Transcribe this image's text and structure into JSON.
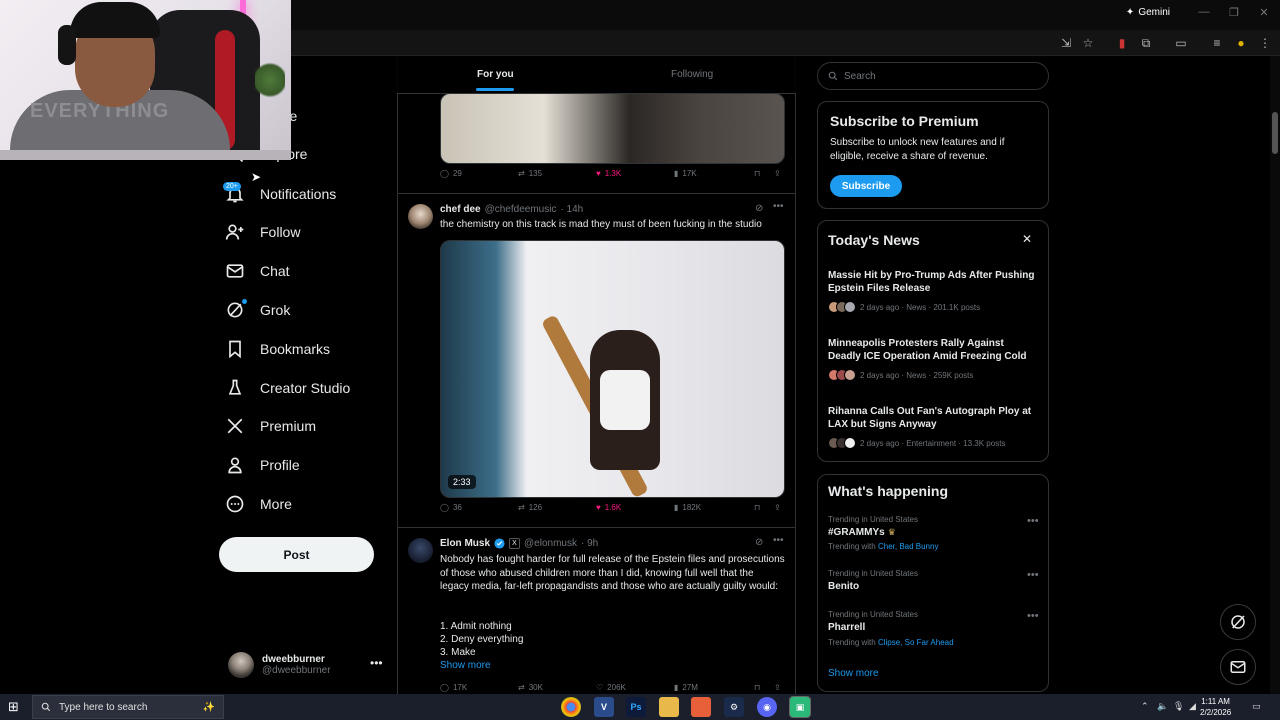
{
  "browser": {
    "gemini_label": "Gemini"
  },
  "nav": {
    "items": [
      {
        "id": "home",
        "label": "Home"
      },
      {
        "id": "explore",
        "label": "Explore"
      },
      {
        "id": "notifications",
        "label": "Notifications",
        "badge": "20+"
      },
      {
        "id": "follow",
        "label": "Follow"
      },
      {
        "id": "chat",
        "label": "Chat"
      },
      {
        "id": "grok",
        "label": "Grok"
      },
      {
        "id": "bookmarks",
        "label": "Bookmarks"
      },
      {
        "id": "creator-studio",
        "label": "Creator Studio"
      },
      {
        "id": "premium",
        "label": "Premium"
      },
      {
        "id": "profile",
        "label": "Profile"
      },
      {
        "id": "more",
        "label": "More"
      }
    ],
    "post_label": "Post",
    "account": {
      "name": "dweebburner",
      "handle": "@dweebburner"
    }
  },
  "feed": {
    "tabs": [
      {
        "label": "For you",
        "active": true
      },
      {
        "label": "Following",
        "active": false
      }
    ],
    "tweets": [
      {
        "actions": {
          "replies": "29",
          "reposts": "135",
          "likes": "1.3K",
          "views": "17K"
        }
      },
      {
        "name": "chef dee",
        "handle": "@chefdeemusic",
        "time": "· 14h",
        "text": "the chemistry on this track is mad they must of been fucking in the studio",
        "duration": "2:33",
        "actions": {
          "replies": "36",
          "reposts": "126",
          "likes": "1.6K",
          "views": "182K"
        }
      },
      {
        "name": "Elon Musk",
        "handle": "@elonmusk",
        "time": "· 9h",
        "text": "Nobody has fought harder for full release of the Epstein files and prosecutions of those who abused children more than I did, knowing full well that the legacy media, far-left propagandists and those who are actually guilty would:",
        "list": [
          "1. Admit nothing",
          "2. Deny everything",
          "3. Make"
        ],
        "show_more": "Show more",
        "actions": {
          "replies": "17K",
          "reposts": "30K",
          "likes": "206K",
          "views": "27M"
        }
      }
    ]
  },
  "sidebar": {
    "search_placeholder": "Search",
    "premium": {
      "title": "Subscribe to Premium",
      "body": "Subscribe to unlock new features and if eligible, receive a share of revenue.",
      "button": "Subscribe"
    },
    "news": {
      "title": "Today's News",
      "items": [
        {
          "title": "Massie Hit by Pro-Trump Ads After Pushing Epstein Files Release",
          "meta": "2 days ago · News · 201.1K posts"
        },
        {
          "title": "Minneapolis Protesters Rally Against Deadly ICE Operation Amid Freezing Cold",
          "meta": "2 days ago · News · 259K posts"
        },
        {
          "title": "Rihanna Calls Out Fan's Autograph Ploy at LAX but Signs Anyway",
          "meta": "2 days ago · Entertainment · 13.3K posts"
        }
      ]
    },
    "happening": {
      "title": "What's happening",
      "items": [
        {
          "context": "Trending in United States",
          "name": "#GRAMMYs",
          "with_label": "Trending with",
          "with": "Cher, Bad Bunny"
        },
        {
          "context": "Trending in United States",
          "name": "Benito",
          "with_label": "",
          "with": ""
        },
        {
          "context": "Trending in United States",
          "name": "Pharrell",
          "with_label": "Trending with",
          "with": "Clipse, So Far Ahead"
        }
      ],
      "show_more": "Show more"
    }
  },
  "taskbar": {
    "search_placeholder": "Type here to search",
    "time": "1:11 AM",
    "date": "2/2/2026"
  },
  "webcam": {
    "shirt_text": "EVERYTHING"
  },
  "colors": {
    "accent": "#1d9bf0",
    "like": "#f91880",
    "background": "#000000",
    "border": "#2f3336"
  }
}
